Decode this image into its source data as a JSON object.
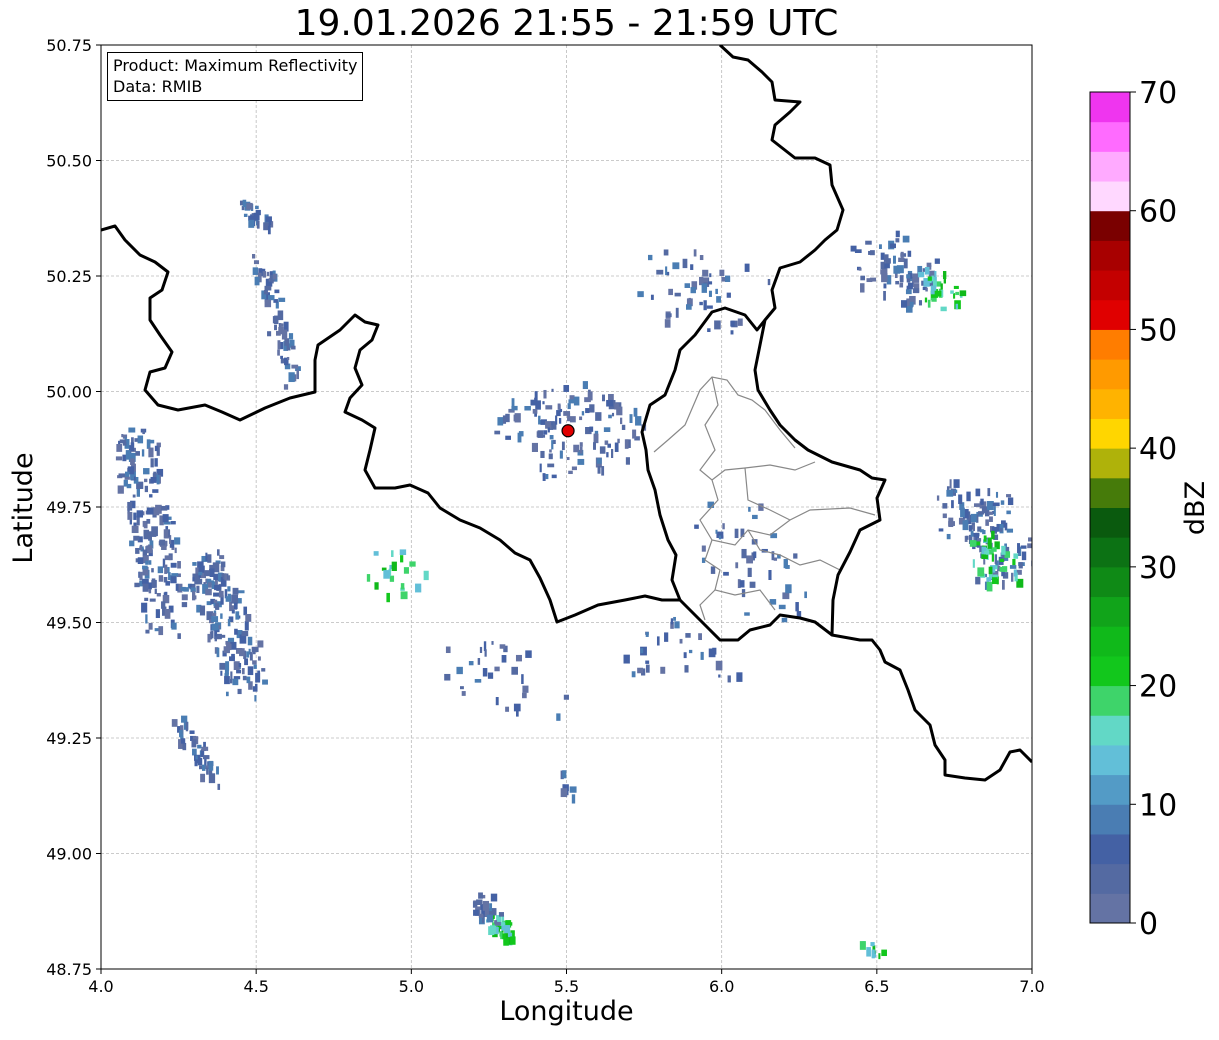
{
  "title": "19.01.2026 21:55 - 21:59 UTC",
  "info_box": {
    "line1": "Product: Maximum Reflectivity",
    "line2": "Data: RMIB"
  },
  "axes": {
    "xlabel": "Longitude",
    "ylabel": "Latitude",
    "x_ticks": [
      "4.0",
      "4.5",
      "5.0",
      "5.5",
      "6.0",
      "6.5",
      "7.0"
    ],
    "y_ticks": [
      "50.75",
      "50.50",
      "50.25",
      "50.00",
      "49.75",
      "49.50",
      "49.25",
      "49.00",
      "48.75"
    ],
    "xlim": [
      4.0,
      7.0
    ],
    "ylim": [
      48.75,
      50.75
    ],
    "grid": true
  },
  "radar_site": {
    "lon": 5.505,
    "lat": 49.915,
    "color": "#e00000"
  },
  "colorbar": {
    "label": "dBZ",
    "min": 0,
    "max": 70,
    "step": 2.5,
    "tick_labels": [
      "0",
      "10",
      "20",
      "30",
      "40",
      "50",
      "60",
      "70"
    ],
    "colors": [
      "#6473a4",
      "#546aa2",
      "#4461a4",
      "#4a7db3",
      "#539bc6",
      "#62bfd8",
      "#62d8c6",
      "#3ed46a",
      "#12c71c",
      "#10b91a",
      "#11a41a",
      "#0f8a16",
      "#0c7214",
      "#0a5a0e",
      "#467b0a",
      "#afb20a",
      "#ffd600",
      "#ffb300",
      "#ff9a00",
      "#ff7d00",
      "#e00000",
      "#c40000",
      "#a80000",
      "#7a0000",
      "#ffd8ff",
      "#ffaaff",
      "#ff6bff",
      "#ef35ef"
    ]
  }
}
